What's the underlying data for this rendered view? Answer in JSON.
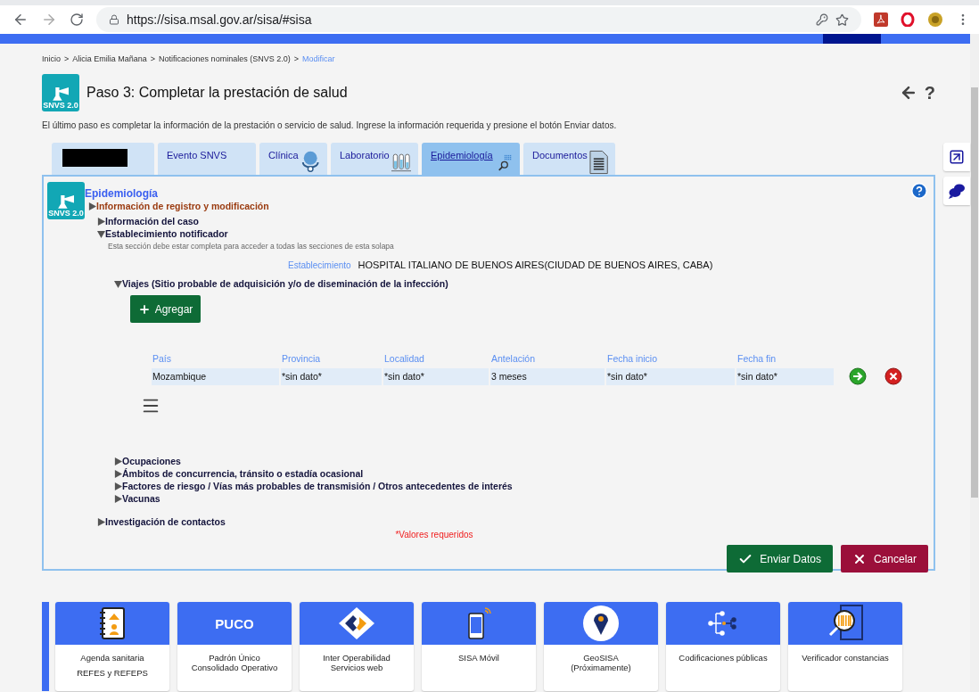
{
  "browser": {
    "url": "https://sisa.msal.gov.ar/sisa/#sisa"
  },
  "breadcrumb": {
    "separator": ">",
    "items": [
      {
        "label": "Inicio",
        "selected": false
      },
      {
        "label": "Alicia Emilia Mañana",
        "selected": false
      },
      {
        "label": "Notificaciones nominales (SNVS 2.0)",
        "selected": false
      },
      {
        "label": "Modificar",
        "selected": true
      }
    ]
  },
  "header": {
    "logo_text": "SNVS 2.0",
    "title": "Paso 3: Completar la prestación de salud",
    "help": "?",
    "description": "El último paso es completar la información de la prestación o servicio de salud. Ingrese la información requerida y presione el botón Enviar datos."
  },
  "tabs": [
    {
      "kind": "redacted",
      "selected": false
    },
    {
      "kind": "plain",
      "label": "Evento SNVS",
      "selected": false
    },
    {
      "kind": "clinic",
      "label": "Clínica",
      "selected": false
    },
    {
      "kind": "lab",
      "label": "Laboratorio",
      "selected": false
    },
    {
      "kind": "epi",
      "label": "Epidemiología",
      "selected": true
    },
    {
      "kind": "docs",
      "label": "Documentos",
      "selected": false
    }
  ],
  "panel": {
    "logo_text": "SNVS 2.0",
    "heading": "Epidemiología",
    "sections": [
      {
        "kind": "header",
        "label": "Información de registro y modificación",
        "expanded": false
      },
      {
        "kind": "section",
        "label": "Información del caso",
        "expanded": false
      },
      {
        "kind": "section",
        "label": "Establecimiento notificador",
        "expanded": true,
        "note": "Esta sección debe estar completa para acceder a todas las secciones de esta solapa",
        "field": {
          "label": "Establecimiento",
          "value": "HOSPITAL ITALIANO DE BUENOS AIRES(CIUDAD DE BUENOS AIRES, CABA)"
        },
        "children": [
          {
            "kind": "table",
            "label": "Viajes (Sitio probable de adquisición y/o de diseminación de la infección)",
            "expanded": true,
            "add_button": "Agregar",
            "columns": [
              "País",
              "Provincia",
              "Localidad",
              "Antelación",
              "Fecha inicio",
              "Fecha fin"
            ],
            "rows": [
              {
                "cells": [
                  "Mozambique",
                  "*sin dato*",
                  "*sin dato*",
                  "3 meses",
                  "*sin dato*",
                  "*sin dato*"
                ]
              }
            ]
          },
          {
            "kind": "section",
            "label": "Ocupaciones",
            "expanded": false
          },
          {
            "kind": "section",
            "label": "Ámbitos de concurrencia, tránsito o estadía ocasional",
            "expanded": false
          },
          {
            "kind": "section",
            "label": "Factores de riesgo / Vías más probables de transmisión / Otros antecedentes de interés",
            "expanded": false
          },
          {
            "kind": "section",
            "label": "Vacunas",
            "expanded": false
          }
        ]
      },
      {
        "kind": "section",
        "label": "Investigación de contactos",
        "expanded": false
      }
    ],
    "required_note": "*Valores requeridos",
    "submit": "Enviar Datos",
    "cancel": "Cancelar"
  },
  "tiles": [
    {
      "kind": "edge"
    },
    {
      "kind": "agenda",
      "lines": [
        "Agenda sanitaria",
        "REFES y REFEPS"
      ]
    },
    {
      "kind": "text",
      "header": "PUCO",
      "lines": [
        "Padrón Único Consolidado Operativo"
      ]
    },
    {
      "kind": "puzzle",
      "lines": [
        "Inter Operabilidad Servicios web"
      ]
    },
    {
      "kind": "phone",
      "lines": [
        "SISA Móvil"
      ]
    },
    {
      "kind": "pin",
      "lines": [
        "GeoSISA (Próximamente)"
      ]
    },
    {
      "kind": "tree",
      "lines": [
        "Codificaciones públicas"
      ]
    },
    {
      "kind": "barcode",
      "lines": [
        "Verificador constancias"
      ]
    }
  ]
}
